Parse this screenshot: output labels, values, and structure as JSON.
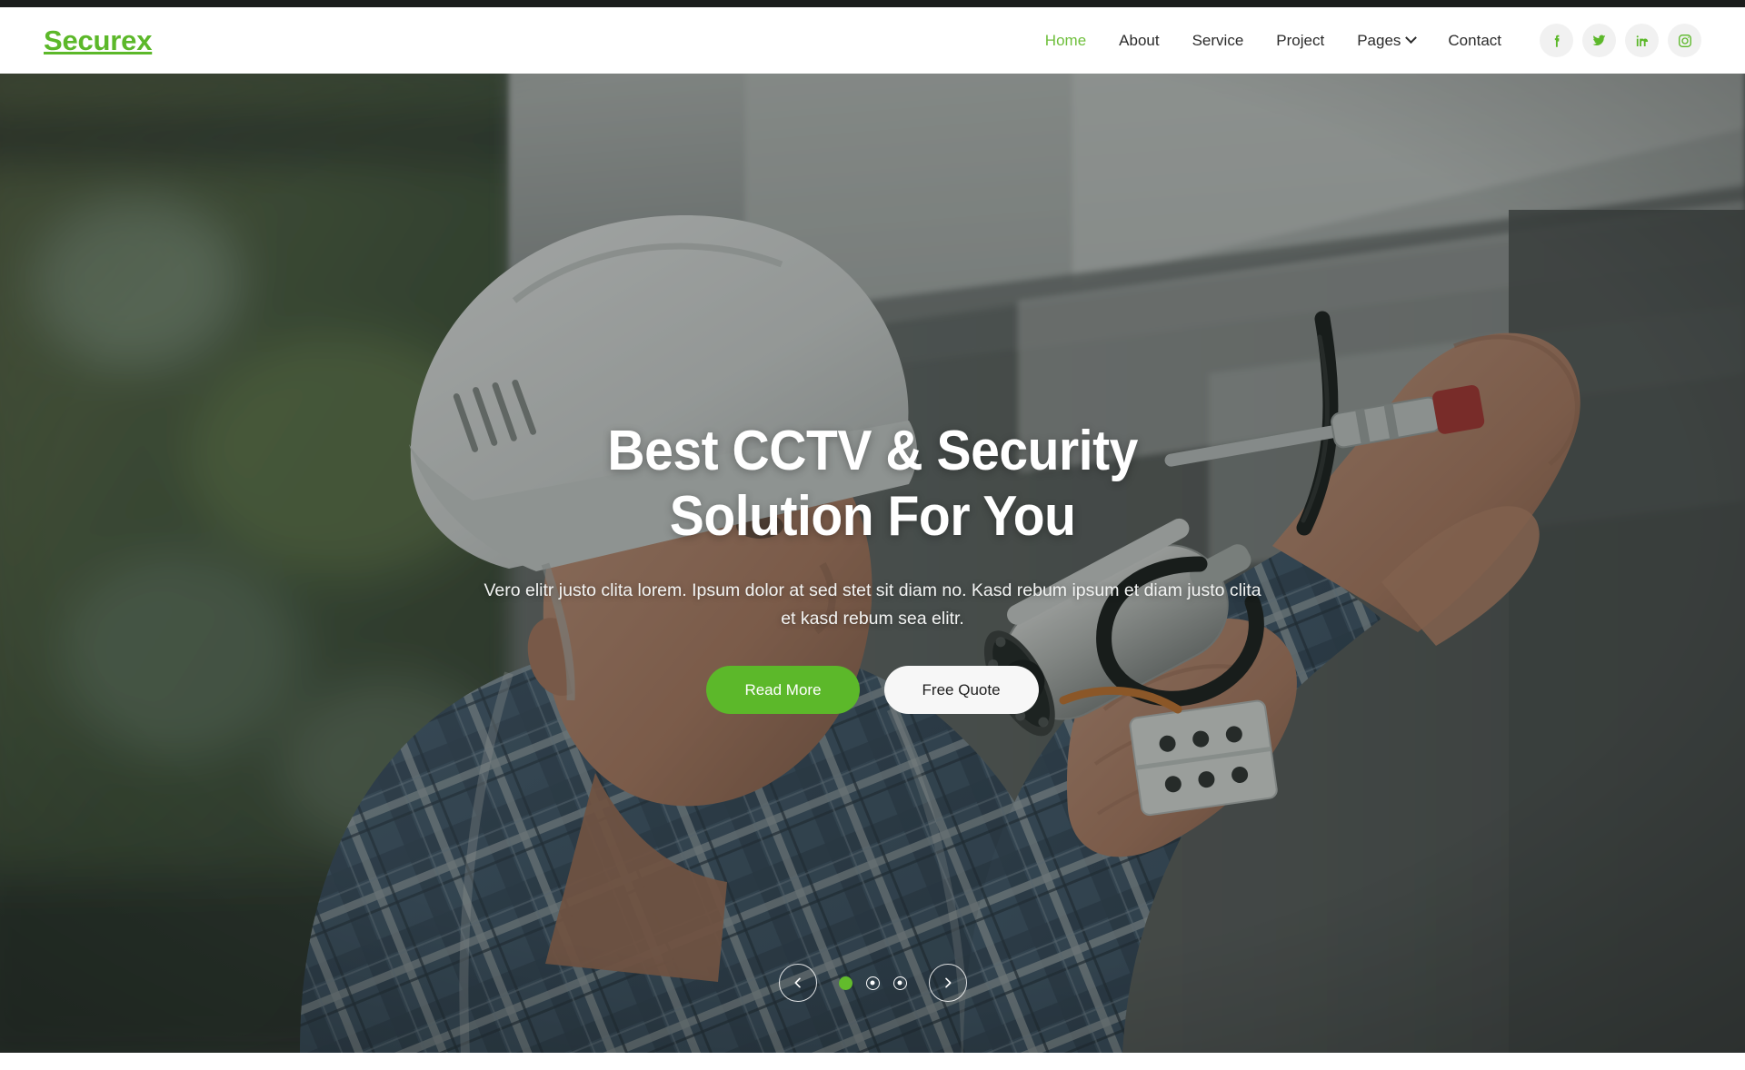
{
  "brand": {
    "name": "Securex",
    "color": "#5cb82a"
  },
  "nav": {
    "items": [
      {
        "label": "Home",
        "active": true,
        "dropdown": false
      },
      {
        "label": "About",
        "active": false,
        "dropdown": false
      },
      {
        "label": "Service",
        "active": false,
        "dropdown": false
      },
      {
        "label": "Project",
        "active": false,
        "dropdown": false
      },
      {
        "label": "Pages",
        "active": false,
        "dropdown": true
      },
      {
        "label": "Contact",
        "active": false,
        "dropdown": false
      }
    ]
  },
  "socials": [
    {
      "name": "facebook-icon",
      "label": "Facebook"
    },
    {
      "name": "twitter-icon",
      "label": "Twitter"
    },
    {
      "name": "linkedin-icon",
      "label": "LinkedIn"
    },
    {
      "name": "instagram-icon",
      "label": "Instagram"
    }
  ],
  "hero": {
    "title_line1": "Best CCTV & Security",
    "title_line2": "Solution For You",
    "subtitle": "Vero elitr justo clita lorem. Ipsum dolor at sed stet sit diam no. Kasd rebum ipsum et diam justo clita et kasd rebum sea elitr.",
    "primary_button": "Read More",
    "secondary_button": "Free Quote",
    "image_description": "Technician in white hard hat installing a CCTV security camera on a ceiling",
    "accent_color": "#5cb82a",
    "overlay_color": "rgba(32,38,36,0.42)"
  },
  "carousel": {
    "prev_label": "Previous slide",
    "next_label": "Next slide",
    "slides": 3,
    "active_slide": 1
  }
}
